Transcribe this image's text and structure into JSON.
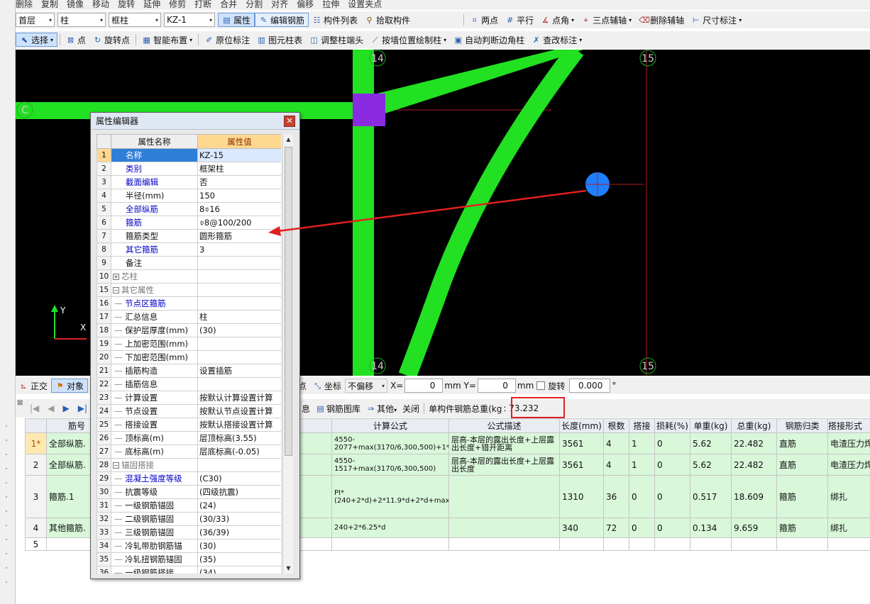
{
  "toolbar_top": {
    "items": [
      "删除",
      "复制",
      "镜像",
      "移动",
      "旋转",
      "延伸",
      "修剪",
      "打断",
      "合并",
      "分割",
      "对齐",
      "偏移",
      "拉伸",
      "设置夹点"
    ]
  },
  "toolbar1": {
    "floor": "首层",
    "component_type": "柱",
    "sub_type": "框柱",
    "component": "KZ-1",
    "property_btn": "属性",
    "edit_rebar_btn": "编辑钢筋",
    "component_list_btn": "构件列表",
    "pick_btn": "拾取构件",
    "two_points_btn": "两点",
    "parallel_btn": "平行",
    "point_angle_btn": "点角",
    "three_point_axis_btn": "三点辅轴",
    "delete_axis_btn": "删除辅轴",
    "dimension_btn": "尺寸标注"
  },
  "toolbar2": {
    "select_btn": "选择",
    "point_btn": "点",
    "rotate_point_btn": "旋转点",
    "smart_layout_btn": "智能布置",
    "origin_label_btn": "原位标注",
    "column_table_btn": "图元柱表",
    "adjust_end_btn": "调整柱端头",
    "draw_by_wall_btn": "按墙位置绘制柱",
    "auto_corner_btn": "自动判断边角柱",
    "check_label_btn": "查改标注"
  },
  "canvas": {
    "axis_labels": [
      "14",
      "15",
      "14",
      "15",
      "C"
    ],
    "axis_y": "Y",
    "axis_x": "X"
  },
  "bottom_bar": {
    "ortho": "正交",
    "snap": "对象",
    "midpoint": "顶点",
    "coord": "坐标",
    "no_offset": "不偏移",
    "x_label": "X=",
    "x_value": "0",
    "y_label": "mm Y=",
    "y_value": "0",
    "mm": "mm",
    "rotate_label": "旋转",
    "rotate_value": "0.000",
    "degree": "°"
  },
  "rebar_toolbar": {
    "info_btn": "息",
    "rebar_lib_btn": "钢筋图库",
    "other_btn": "其他",
    "close_btn": "关闭",
    "total_label": "单构件钢筋总重(kg",
    "total_value": ": 73.232"
  },
  "rebar_table": {
    "headers": [
      "筋号",
      "计算公式",
      "公式描述",
      "长度(mm)",
      "根数",
      "搭接",
      "损耗(%)",
      "单重(kg)",
      "总重(kg)",
      "钢筋归类",
      "搭接形式"
    ],
    "rows": [
      {
        "no": "1*",
        "name": "全部纵筋.",
        "formula": "4550-2077+max(3170/6,300,500)+1*max(35*d,500)",
        "desc": "层高-本层的露出长度+上层露出长度+错开距离",
        "len": "3561",
        "count": "4",
        "lap": "1",
        "loss": "0",
        "unit": "5.62",
        "total": "22.482",
        "cat": "直筋",
        "lapform": "电渣压力焊"
      },
      {
        "no": "2",
        "name": "全部纵筋.",
        "formula": "4550-1517+max(3170/6,300,500)",
        "desc": "层高-本层的露出长度+上层露出长度",
        "len": "3561",
        "count": "4",
        "lap": "1",
        "loss": "0",
        "unit": "5.62",
        "total": "22.482",
        "cat": "直筋",
        "lapform": "电渣压力焊"
      },
      {
        "no": "3",
        "name": "箍筋.1",
        "formula": "PI*(240+2*d)+2*11.9*d+2*d+max(24*d,300)",
        "desc": "",
        "len": "1310",
        "count": "36",
        "lap": "0",
        "loss": "0",
        "unit": "0.517",
        "total": "18.609",
        "cat": "箍筋",
        "lapform": "绑扎"
      },
      {
        "no": "4",
        "name": "其他箍筋.",
        "formula": "240+2*6.25*d",
        "desc": "",
        "len": "340",
        "count": "72",
        "lap": "0",
        "loss": "0",
        "unit": "0.134",
        "total": "9.659",
        "cat": "箍筋",
        "lapform": "绑扎"
      },
      {
        "no": "5",
        "name": "",
        "formula": "",
        "desc": "",
        "len": "",
        "count": "",
        "lap": "",
        "loss": "",
        "unit": "",
        "total": "",
        "cat": "",
        "lapform": ""
      }
    ]
  },
  "property_editor": {
    "title": "属性编辑器",
    "col_name": "属性名称",
    "col_value": "属性值",
    "rows": [
      {
        "n": "1",
        "k": "名称",
        "v": "KZ-15"
      },
      {
        "n": "2",
        "k": "类别",
        "v": "框架柱"
      },
      {
        "n": "3",
        "k": "截面编辑",
        "v": "否"
      },
      {
        "n": "4",
        "k": "半径(mm)",
        "v": "150"
      },
      {
        "n": "5",
        "k": "全部纵筋",
        "v": "8⌽16"
      },
      {
        "n": "6",
        "k": "箍筋",
        "v": "⌽8@100/200"
      },
      {
        "n": "7",
        "k": "箍筋类型",
        "v": "圆形箍筋"
      },
      {
        "n": "8",
        "k": "其它箍筋",
        "v": "3"
      },
      {
        "n": "9",
        "k": "备注",
        "v": ""
      },
      {
        "n": "10",
        "k": "芯柱",
        "v": ""
      },
      {
        "n": "15",
        "k": "其它属性",
        "v": ""
      },
      {
        "n": "16",
        "k": "节点区箍筋",
        "v": ""
      },
      {
        "n": "17",
        "k": "汇总信息",
        "v": "柱"
      },
      {
        "n": "18",
        "k": "保护层厚度(mm)",
        "v": "(30)"
      },
      {
        "n": "19",
        "k": "上加密范围(mm)",
        "v": ""
      },
      {
        "n": "20",
        "k": "下加密范围(mm)",
        "v": ""
      },
      {
        "n": "21",
        "k": "插筋构造",
        "v": "设置插筋"
      },
      {
        "n": "22",
        "k": "插筋信息",
        "v": ""
      },
      {
        "n": "23",
        "k": "计算设置",
        "v": "按默认计算设置计算"
      },
      {
        "n": "24",
        "k": "节点设置",
        "v": "按默认节点设置计算"
      },
      {
        "n": "25",
        "k": "搭接设置",
        "v": "按默认搭接设置计算"
      },
      {
        "n": "26",
        "k": "顶标高(m)",
        "v": "层顶标高(3.55)"
      },
      {
        "n": "27",
        "k": "底标高(m)",
        "v": "层底标高(-0.05)"
      },
      {
        "n": "28",
        "k": "锚固搭接",
        "v": ""
      },
      {
        "n": "29",
        "k": "混凝土强度等级",
        "v": "(C30)"
      },
      {
        "n": "30",
        "k": "抗震等级",
        "v": "(四级抗震)"
      },
      {
        "n": "31",
        "k": "一级钢筋锚固",
        "v": "(24)"
      },
      {
        "n": "32",
        "k": "二级钢筋锚固",
        "v": "(30/33)"
      },
      {
        "n": "33",
        "k": "三级钢筋锚固",
        "v": "(36/39)"
      },
      {
        "n": "34",
        "k": "冷轧带肋钢筋锚",
        "v": "(30)"
      },
      {
        "n": "35",
        "k": "冷轧扭钢筋锚固",
        "v": "(35)"
      },
      {
        "n": "36",
        "k": "一级钢筋搭接",
        "v": "(34)"
      }
    ]
  },
  "colors": {
    "canvas_bg": "#000000",
    "beam_green": "#22e022",
    "column_purple": "#8a2be2",
    "circle_column": "#1e7fff",
    "axis_red": "#cc2222",
    "arrow_red": "#e02020"
  }
}
